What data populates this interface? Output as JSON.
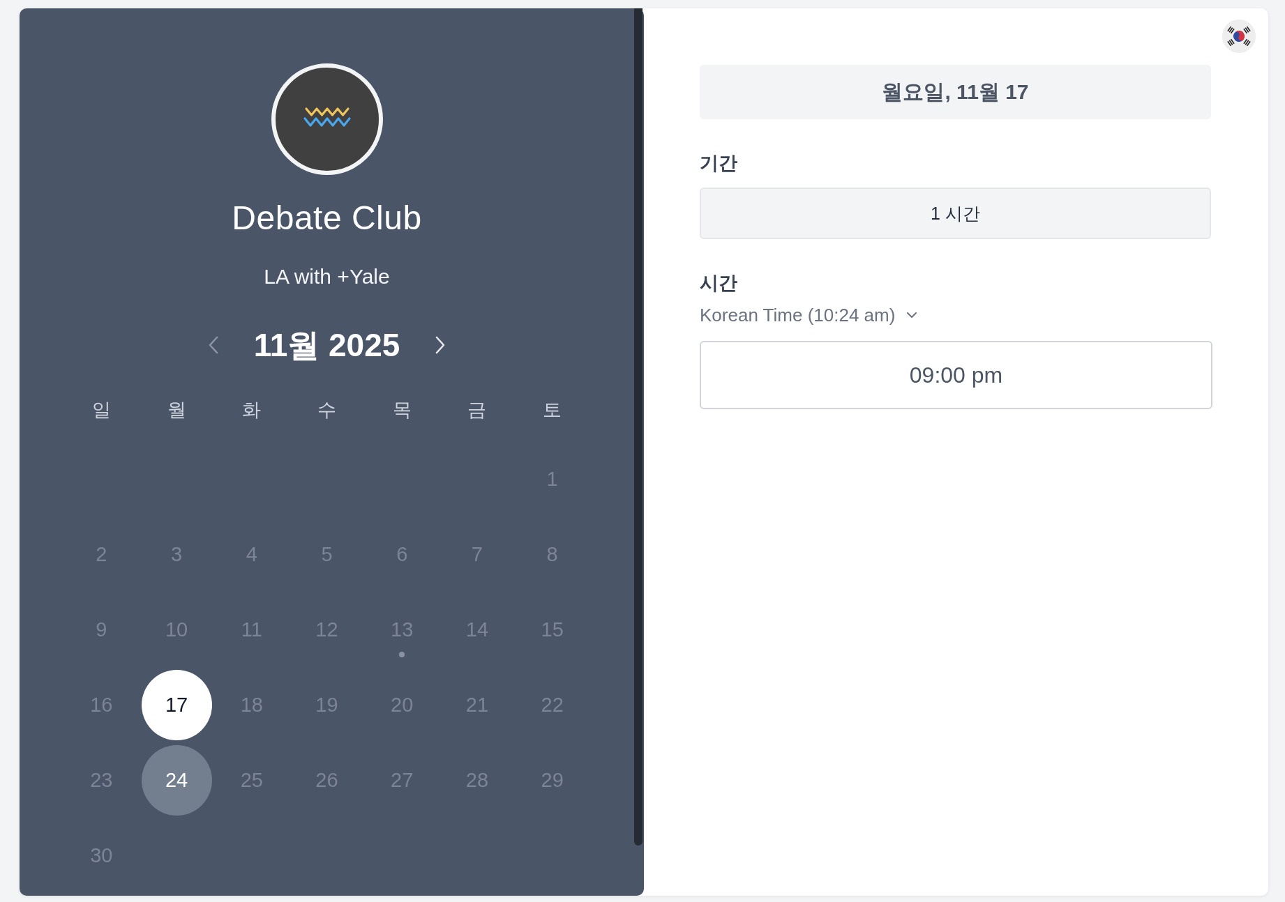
{
  "event": {
    "title": "Debate Club",
    "subtitle": "LA with +Yale"
  },
  "calendar": {
    "month_label": "11월 2025",
    "prev_button": {
      "disabled": true
    },
    "next_button": {
      "disabled": false
    },
    "weekdays": [
      "일",
      "월",
      "화",
      "수",
      "목",
      "금",
      "토"
    ],
    "weeks": [
      {
        "days": [
          {
            "label": "1",
            "selected": false,
            "available": false,
            "today": false
          }
        ]
      },
      {
        "days": [
          {
            "label": "2",
            "selected": false,
            "available": false,
            "today": false
          },
          {
            "label": "3",
            "selected": false,
            "available": false,
            "today": false
          },
          {
            "label": "4",
            "selected": false,
            "available": false,
            "today": false
          },
          {
            "label": "5",
            "selected": false,
            "available": false,
            "today": false
          },
          {
            "label": "6",
            "selected": false,
            "available": false,
            "today": false
          },
          {
            "label": "7",
            "selected": false,
            "available": false,
            "today": false
          },
          {
            "label": "8",
            "selected": false,
            "available": false,
            "today": false
          }
        ]
      },
      {
        "days": [
          {
            "label": "9",
            "selected": false,
            "available": false,
            "today": false
          },
          {
            "label": "10",
            "selected": false,
            "available": false,
            "today": false
          },
          {
            "label": "11",
            "selected": false,
            "available": false,
            "today": false
          },
          {
            "label": "12",
            "selected": false,
            "available": false,
            "today": false
          },
          {
            "label": "13",
            "selected": false,
            "available": false,
            "today": true
          },
          {
            "label": "14",
            "selected": false,
            "available": false,
            "today": false
          },
          {
            "label": "15",
            "selected": false,
            "available": false,
            "today": false
          }
        ]
      },
      {
        "days": [
          {
            "label": "16",
            "selected": false,
            "available": false,
            "today": false
          },
          {
            "label": "17",
            "selected": true,
            "available": true,
            "today": false
          },
          {
            "label": "18",
            "selected": false,
            "available": false,
            "today": false
          },
          {
            "label": "19",
            "selected": false,
            "available": false,
            "today": false
          },
          {
            "label": "20",
            "selected": false,
            "available": false,
            "today": false
          },
          {
            "label": "21",
            "selected": false,
            "available": false,
            "today": false
          },
          {
            "label": "22",
            "selected": false,
            "available": false,
            "today": false
          }
        ]
      },
      {
        "days": [
          {
            "label": "23",
            "selected": false,
            "available": false,
            "today": false
          },
          {
            "label": "24",
            "selected": false,
            "available": true,
            "today": false
          },
          {
            "label": "25",
            "selected": false,
            "available": false,
            "today": false
          },
          {
            "label": "26",
            "selected": false,
            "available": false,
            "today": false
          },
          {
            "label": "27",
            "selected": false,
            "available": false,
            "today": false
          },
          {
            "label": "28",
            "selected": false,
            "available": false,
            "today": false
          },
          {
            "label": "29",
            "selected": false,
            "available": false,
            "today": false
          }
        ]
      },
      {
        "days": [
          {
            "label": "30",
            "selected": false,
            "available": false,
            "today": false
          }
        ]
      }
    ]
  },
  "booking": {
    "date_heading": "월요일, 11월 17",
    "duration": {
      "label": "기간",
      "value": "1 시간"
    },
    "time": {
      "label": "시간",
      "timezone": "Korean Time (10:24 am)",
      "slots": [
        {
          "label": "09:00 pm",
          "selected": false
        }
      ]
    }
  }
}
